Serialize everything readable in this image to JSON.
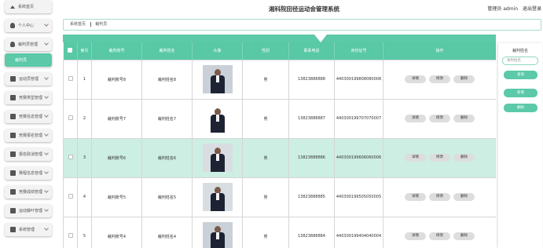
{
  "header": {
    "title": "湘科院田径运动会管理系统",
    "user": "管理员 admin",
    "logout": "退出登录"
  },
  "breadcrumb": {
    "home": "系统首页",
    "current": "裁判员"
  },
  "sidebar": {
    "items": [
      {
        "label": "系统首页",
        "icon": "home-icon"
      },
      {
        "label": "个人中心",
        "icon": "user-icon"
      },
      {
        "label": "裁判员管理",
        "icon": "user-icon"
      },
      {
        "label": "裁判员",
        "icon": ""
      },
      {
        "label": "运动员管理",
        "icon": "grid-icon"
      },
      {
        "label": "竞赛类型管理",
        "icon": "grid-icon"
      },
      {
        "label": "竞赛信息管理",
        "icon": "grid-icon"
      },
      {
        "label": "竞赛报名管理",
        "icon": "grid-icon"
      },
      {
        "label": "报名取消管理",
        "icon": "grid-icon"
      },
      {
        "label": "赛程信息管理",
        "icon": "grid-icon"
      },
      {
        "label": "竞赛成绩管理",
        "icon": "grid-icon"
      },
      {
        "label": "运动藤叶管理",
        "icon": "grid-icon"
      },
      {
        "label": "系统管理",
        "icon": "gear-icon"
      }
    ]
  },
  "table": {
    "headers": [
      "",
      "索引",
      "裁判账号",
      "裁判姓名",
      "头像",
      "性别",
      "联系电话",
      "身份证号",
      "操作"
    ],
    "rows": [
      {
        "index": "1",
        "account": "裁判账号8",
        "name": "裁判姓名8",
        "gender": "男",
        "phone": "13823888888",
        "idcard": "440300199808080008"
      },
      {
        "index": "2",
        "account": "裁判账号7",
        "name": "裁判姓名7",
        "gender": "男",
        "phone": "13823888887",
        "idcard": "440300199707070007"
      },
      {
        "index": "3",
        "account": "裁判账号6",
        "name": "裁判姓名6",
        "gender": "男",
        "phone": "13823888886",
        "idcard": "440300199606060006"
      },
      {
        "index": "4",
        "account": "裁判账号5",
        "name": "裁判姓名5",
        "gender": "男",
        "phone": "13823888885",
        "idcard": "440300199505050005"
      },
      {
        "index": "5",
        "account": "裁判账号4",
        "name": "裁判姓名4",
        "gender": "男",
        "phone": "13823888884",
        "idcard": "440300199404040004"
      }
    ],
    "actions": {
      "detail": "详情",
      "edit": "修改",
      "delete": "删除"
    }
  },
  "search": {
    "label": "裁判姓名",
    "placeholder": "裁判姓名",
    "query": "查询",
    "add": "新增",
    "delete": "删除"
  },
  "colors": {
    "accent": "#5cc9a8",
    "selected_row": "#cdeee2"
  }
}
